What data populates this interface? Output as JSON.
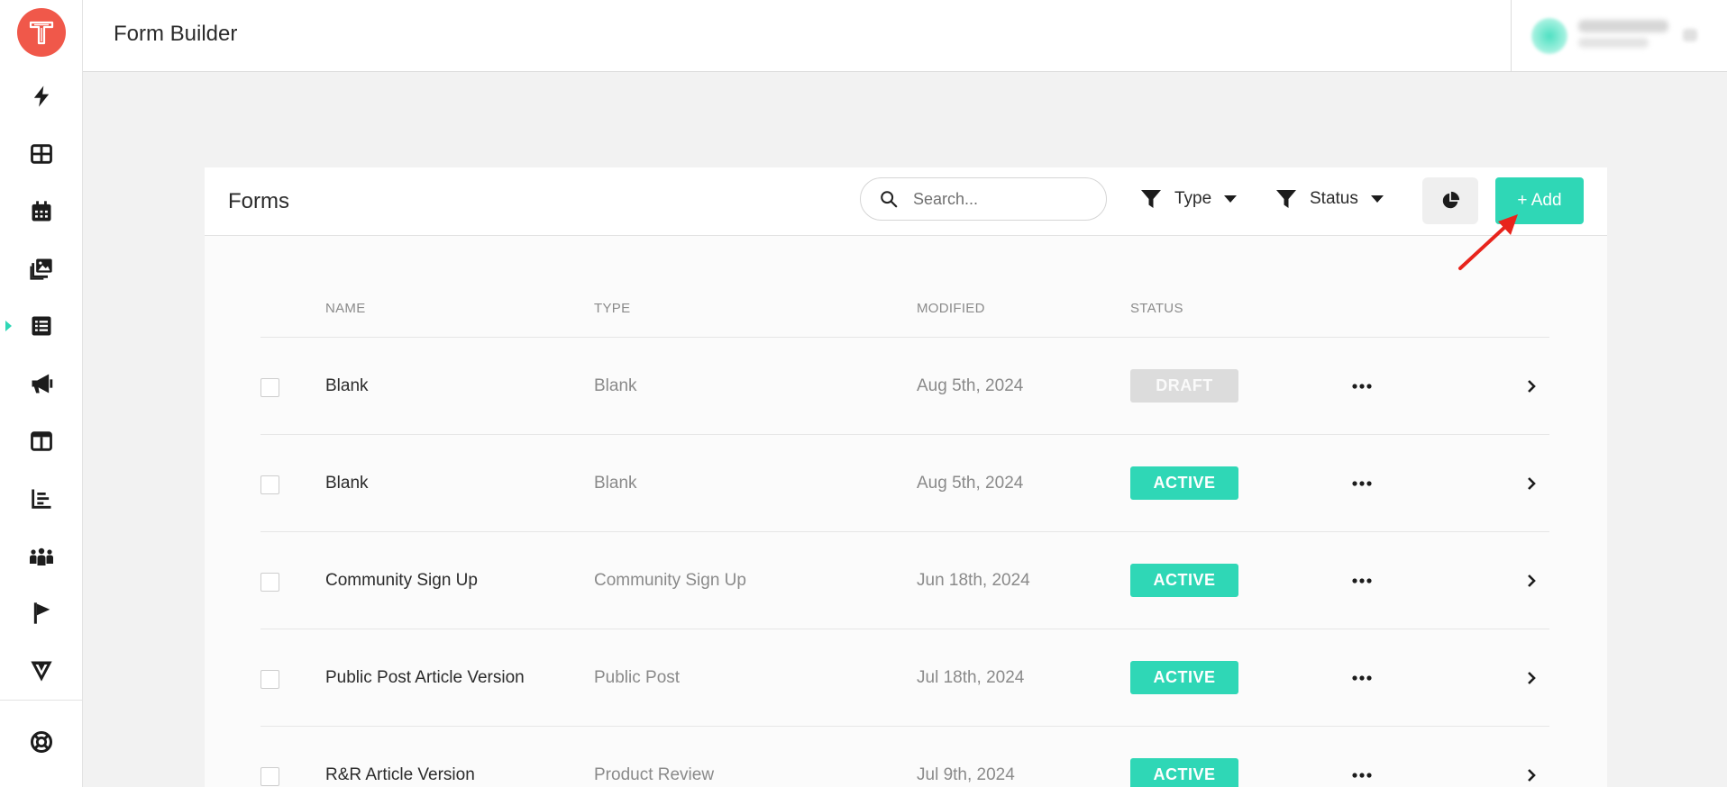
{
  "header": {
    "title": "Form Builder"
  },
  "sidebar": {
    "logo_letter": "T",
    "items": [
      {
        "icon": "bolt-icon"
      },
      {
        "icon": "grid-icon"
      },
      {
        "icon": "calendar-icon"
      },
      {
        "icon": "images-icon"
      },
      {
        "icon": "list-icon",
        "active": true
      },
      {
        "icon": "megaphone-icon"
      },
      {
        "icon": "layout-icon"
      },
      {
        "icon": "bar-chart-icon"
      },
      {
        "icon": "users-icon"
      },
      {
        "icon": "flag-icon"
      },
      {
        "icon": "v-logo-icon"
      }
    ],
    "bottom_icon": "lifebuoy-icon"
  },
  "card": {
    "title": "Forms",
    "search_placeholder": "Search...",
    "filters": {
      "type_label": "Type",
      "status_label": "Status"
    },
    "add_label": "+ Add"
  },
  "table": {
    "columns": {
      "name": "NAME",
      "type": "TYPE",
      "modified": "MODIFIED",
      "status": "STATUS"
    },
    "rows": [
      {
        "name": "Blank",
        "type": "Blank",
        "modified": "Aug 5th, 2024",
        "status": "DRAFT"
      },
      {
        "name": "Blank",
        "type": "Blank",
        "modified": "Aug 5th, 2024",
        "status": "ACTIVE"
      },
      {
        "name": "Community Sign Up",
        "type": "Community Sign Up",
        "modified": "Jun 18th, 2024",
        "status": "ACTIVE"
      },
      {
        "name": "Public Post Article Version",
        "type": "Public Post",
        "modified": "Jul 18th, 2024",
        "status": "ACTIVE"
      },
      {
        "name": "R&R Article Version",
        "type": "Product Review",
        "modified": "Jul 9th, 2024",
        "status": "ACTIVE"
      }
    ]
  },
  "colors": {
    "accent": "#2fd7b6",
    "logo": "#f0584a",
    "draft": "#dcdcdc",
    "annotation": "#e8241c"
  }
}
